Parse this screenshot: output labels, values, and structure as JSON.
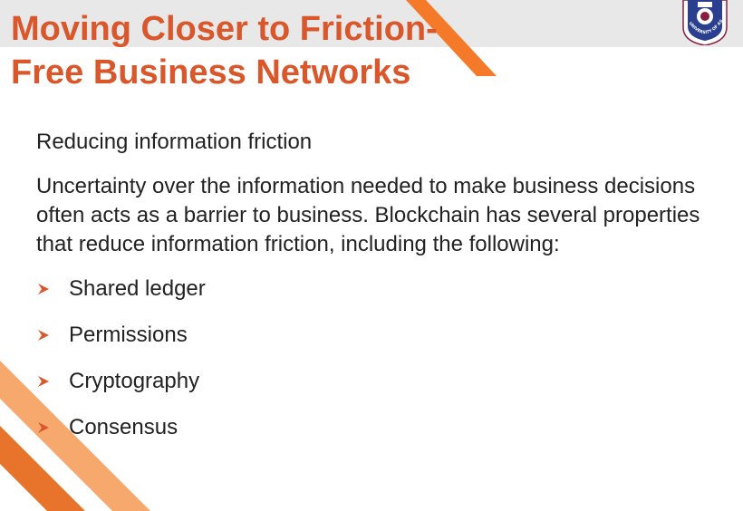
{
  "slide": {
    "title_line1": "Moving Closer to Friction-",
    "title_line2": "Free Business Networks",
    "subheading": "Reducing information friction",
    "paragraph": "Uncertainty over the information needed to make business decisions often acts as a barrier to business. Blockchain has several properties that reduce information friction, including the following:",
    "bullets": [
      {
        "label": "Shared ledger"
      },
      {
        "label": "Permissions"
      },
      {
        "label": "Cryptography"
      },
      {
        "label": "Consensus"
      }
    ]
  },
  "logo": {
    "text": "UNIVERSITY OF ASIA PACIFIC"
  },
  "colors": {
    "title": "#d9572a",
    "accent_orange": "#f47a2a",
    "accent_light": "#f7a86d",
    "arrow": "#d9572a",
    "band": "#e8e8e8",
    "logo_maroon": "#8c1d40"
  }
}
